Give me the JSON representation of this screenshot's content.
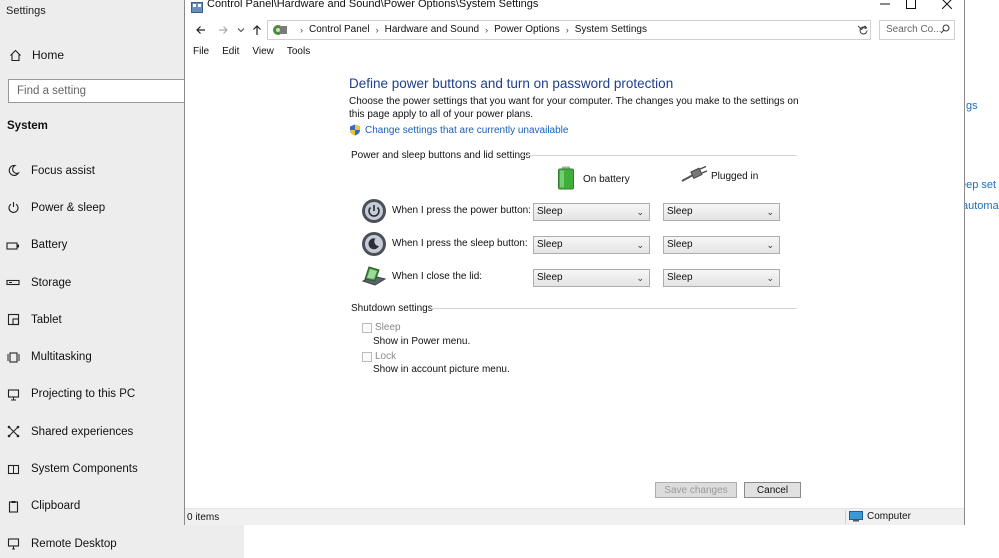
{
  "settings": {
    "app_title": "Settings",
    "home_label": "Home",
    "search_placeholder": "Find a setting",
    "section_label": "System",
    "nav": [
      {
        "label": "Focus assist",
        "icon": "moon-icon"
      },
      {
        "label": "Power & sleep",
        "icon": "power-icon"
      },
      {
        "label": "Battery",
        "icon": "battery-icon"
      },
      {
        "label": "Storage",
        "icon": "storage-icon"
      },
      {
        "label": "Tablet",
        "icon": "tablet-icon"
      },
      {
        "label": "Multitasking",
        "icon": "multitasking-icon"
      },
      {
        "label": "Projecting to this PC",
        "icon": "projecting-icon"
      },
      {
        "label": "Shared experiences",
        "icon": "shared-icon"
      },
      {
        "label": "System Components",
        "icon": "components-icon"
      },
      {
        "label": "Clipboard",
        "icon": "clipboard-icon"
      },
      {
        "label": "Remote Desktop",
        "icon": "remote-desktop-icon"
      }
    ],
    "right_peek": [
      "gs",
      "eep set",
      "automa"
    ]
  },
  "window": {
    "title": "Control Panel\\Hardware and Sound\\Power Options\\System Settings",
    "address": [
      "Control Panel",
      "Hardware and Sound",
      "Power Options",
      "System Settings"
    ],
    "search_placeholder": "Search Co...",
    "menu": [
      "File",
      "Edit",
      "View",
      "Tools"
    ]
  },
  "page": {
    "heading": "Define power buttons and turn on password protection",
    "description": "Choose the power settings that you want for your computer. The changes you make to the settings on this page apply to all of your power plans.",
    "uac_link": "Change settings that are currently unavailable",
    "group_power": "Power and sleep buttons and lid settings",
    "col_battery": "On battery",
    "col_plugged": "Plugged in",
    "rows": [
      {
        "label": "When I press the power button:",
        "battery": "Sleep",
        "plugged": "Sleep"
      },
      {
        "label": "When I press the sleep button:",
        "battery": "Sleep",
        "plugged": "Sleep"
      },
      {
        "label": "When I close the lid:",
        "battery": "Sleep",
        "plugged": "Sleep"
      }
    ],
    "group_shutdown": "Shutdown settings",
    "shutdown": [
      {
        "label": "Sleep",
        "sub": "Show in Power menu.",
        "checked": false
      },
      {
        "label": "Lock",
        "sub": "Show in account picture menu.",
        "checked": false
      }
    ],
    "save_label": "Save changes",
    "cancel_label": "Cancel"
  },
  "status": {
    "items": "0 items",
    "computer": "Computer"
  },
  "colors": {
    "heading": "#1e3f8a",
    "link": "#1a5fb4",
    "settings_sidebar": "#ededed"
  }
}
